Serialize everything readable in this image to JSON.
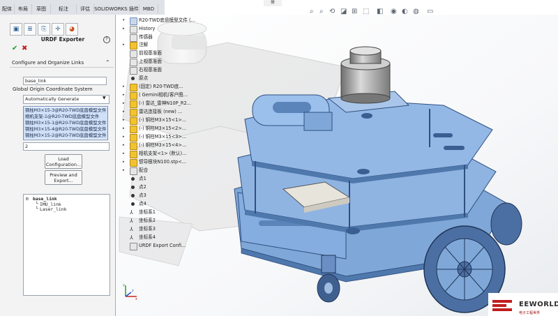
{
  "ribbon": {
    "tabs": [
      "配体",
      "布局",
      "草图",
      "标注",
      "评估",
      "SOLIDWORKS 插件",
      "MBD"
    ],
    "title_fragment": "体"
  },
  "panel": {
    "title": "URDF Exporter",
    "help_icon": "?",
    "ok_icon": "✔",
    "cancel_icon": "✖",
    "section_header": "Configure and Organize Links",
    "link_name": "base_link",
    "coord_label": "Global Origin Coordinate System",
    "coord_value": "Automatically Generate",
    "component_list": [
      "铜柱M3×15-3@R20-TWD底盘模型文件",
      "相机支架-1@R20-TWD底盘模型文件",
      "铜柱M3×15-1@R20-TWD底盘模型文件",
      "铜柱M3×15-4@R20-TWD底盘模型文件",
      "铜柱M3×15-2@R20-TWD底盘模型文件"
    ],
    "child_count": "2",
    "load_button": [
      "Load",
      "Configuration..."
    ],
    "preview_button": [
      "Preview and",
      "Export..."
    ],
    "link_tree": {
      "root": "base_link",
      "children": [
        "IMU_link",
        "Laser_link"
      ]
    }
  },
  "feature_tree": {
    "items": [
      {
        "label": "R20-TWD底盘模型文件 (...",
        "icon": "assembly-icon",
        "arrow": "▾"
      },
      {
        "label": "History",
        "icon": "history-icon",
        "arrow": "▸"
      },
      {
        "label": "传感器",
        "icon": "sensor-icon",
        "arrow": ""
      },
      {
        "label": "注解",
        "icon": "annotation-icon",
        "arrow": "▸"
      },
      {
        "label": "前视基准面",
        "icon": "plane-icon",
        "arrow": ""
      },
      {
        "label": "上视基准面",
        "icon": "plane-icon",
        "arrow": ""
      },
      {
        "label": "右视基准面",
        "icon": "plane-icon",
        "arrow": ""
      },
      {
        "label": "原点",
        "icon": "origin-icon",
        "arrow": ""
      },
      {
        "label": "(固定) R20-TWD底...",
        "icon": "part-icon",
        "arrow": "▸"
      },
      {
        "label": "( Gemini相机(客户图...",
        "icon": "part-icon",
        "arrow": "▸"
      },
      {
        "label": "(-) 雷达_雷神N10P_R2...",
        "icon": "part-icon",
        "arrow": "▸"
      },
      {
        "label": "雷达连接板 (new) ...",
        "icon": "part-icon",
        "arrow": "▸"
      },
      {
        "label": "(-) 铜柱M3×15<1>...",
        "icon": "part-icon",
        "arrow": "▸"
      },
      {
        "label": "(-) 铜柱M3×15<2>...",
        "icon": "part-icon",
        "arrow": "▸"
      },
      {
        "label": "(-) 铜柱M3×15<3>...",
        "icon": "part-icon",
        "arrow": "▸"
      },
      {
        "label": "(-) 铜柱M3×15<4>...",
        "icon": "part-icon",
        "arrow": "▸"
      },
      {
        "label": "相机支架<1> (默认)...",
        "icon": "part-icon",
        "arrow": "▸"
      },
      {
        "label": "惯导模块N100.stp<...",
        "icon": "part-icon",
        "arrow": "▸"
      },
      {
        "label": "配合",
        "icon": "mate-icon",
        "arrow": "▸"
      },
      {
        "label": "点1",
        "icon": "point-icon",
        "arrow": ""
      },
      {
        "label": "点2",
        "icon": "point-icon",
        "arrow": ""
      },
      {
        "label": "点3",
        "icon": "point-icon",
        "arrow": ""
      },
      {
        "label": "点4",
        "icon": "point-icon",
        "arrow": ""
      },
      {
        "label": "坐标系1",
        "icon": "coordinate-system-icon",
        "arrow": ""
      },
      {
        "label": "坐标系2",
        "icon": "coordinate-system-icon",
        "arrow": ""
      },
      {
        "label": "坐标系3",
        "icon": "coordinate-system-icon",
        "arrow": ""
      },
      {
        "label": "坐标系4",
        "icon": "coordinate-system-icon",
        "arrow": ""
      },
      {
        "label": "URDF Export Confi...",
        "icon": "urdf-config-icon",
        "arrow": ""
      }
    ]
  },
  "triad": {
    "x": "x",
    "y": "y",
    "z": "z"
  },
  "watermark": {
    "name": "EEWORLD",
    "sub": "电子工程世界"
  },
  "colors": {
    "model_blue": "#7fa8d8",
    "model_blue_dark": "#4f78ad",
    "folder_yellow": "#f1c232",
    "ok_green": "#1b9a2c",
    "cancel_red": "#c41b1b"
  }
}
